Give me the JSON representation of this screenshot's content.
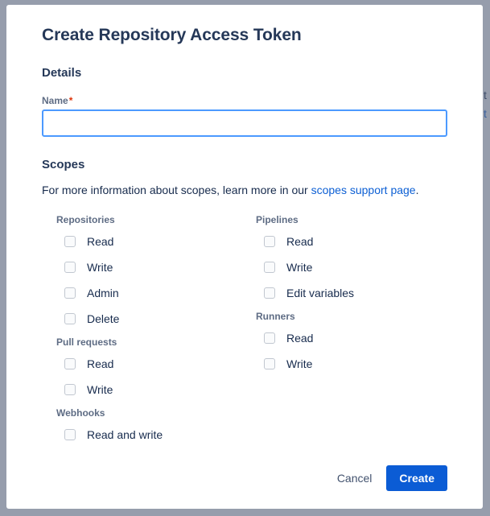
{
  "background_page": {
    "visible_fragments": [
      "t",
      "t"
    ]
  },
  "modal": {
    "title": "Create Repository Access Token",
    "details": {
      "heading": "Details",
      "name_label": "Name",
      "required_marker": "*",
      "name_value": "",
      "name_placeholder": ""
    },
    "scopes": {
      "heading": "Scopes",
      "description_prefix": "For more information about scopes, learn more in our ",
      "link_text": "scopes support page",
      "description_suffix": ".",
      "columns": [
        {
          "groups": [
            {
              "title": "Repositories",
              "items": [
                {
                  "label": "Read",
                  "checked": false
                },
                {
                  "label": "Write",
                  "checked": false
                },
                {
                  "label": "Admin",
                  "checked": false
                },
                {
                  "label": "Delete",
                  "checked": false
                }
              ]
            },
            {
              "title": "Pull requests",
              "items": [
                {
                  "label": "Read",
                  "checked": false
                },
                {
                  "label": "Write",
                  "checked": false
                }
              ]
            },
            {
              "title": "Webhooks",
              "items": [
                {
                  "label": "Read and write",
                  "checked": false
                }
              ]
            }
          ]
        },
        {
          "groups": [
            {
              "title": "Pipelines",
              "items": [
                {
                  "label": "Read",
                  "checked": false
                },
                {
                  "label": "Write",
                  "checked": false
                },
                {
                  "label": "Edit variables",
                  "checked": false
                }
              ]
            },
            {
              "title": "Runners",
              "items": [
                {
                  "label": "Read",
                  "checked": false
                },
                {
                  "label": "Write",
                  "checked": false
                }
              ]
            }
          ]
        }
      ]
    },
    "footer": {
      "cancel_label": "Cancel",
      "create_label": "Create"
    }
  },
  "colors": {
    "backdrop": "#7d8699",
    "modal_background": "#ffffff",
    "title_text": "#253858",
    "body_text": "#172b4d",
    "muted_text": "#5e6c84",
    "link": "#0c5fd4",
    "required_star": "#de350b",
    "input_focus_border": "#4c9aff",
    "primary_button": "#0b5cd5",
    "checkbox_border": "#c1c7d0"
  }
}
